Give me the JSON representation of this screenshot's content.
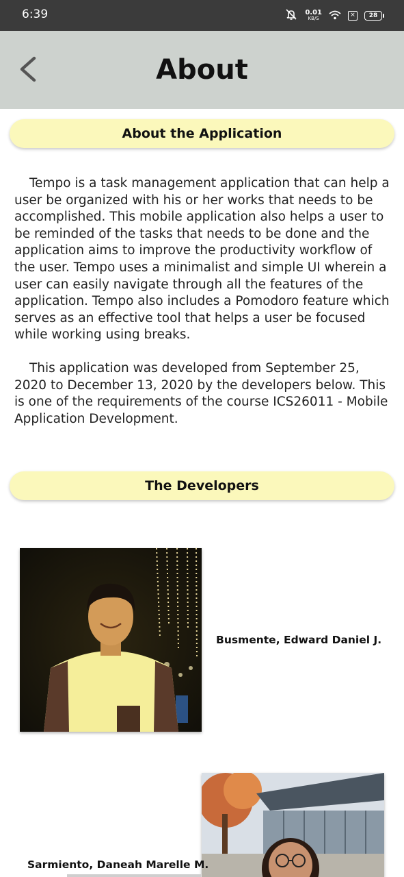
{
  "status_bar": {
    "time": "6:39",
    "net_speed_value": "0.01",
    "net_speed_unit": "KB/S",
    "sim_label": "×",
    "battery_level": "28"
  },
  "header": {
    "title": "About",
    "back_icon": "chevron-left-icon"
  },
  "about_section": {
    "heading": "About the Application",
    "paragraph1": "Tempo is a task management application that can help a user be organized with his or her works that needs to be accomplished. This mobile application also helps a user to be reminded of the tasks that needs to be done and the application aims to improve the productivity workflow of the user. Tempo uses a minimalist and simple UI wherein a user can easily navigate through all the features of the application. Tempo also includes a Pomodoro feature which serves as an effective tool that helps a user be focused while working using breaks.",
    "paragraph2": "This application was developed from September 25, 2020 to December 13, 2020 by the developers below. This is one of the requirements of the course ICS26011 - Mobile Application Development."
  },
  "developers_section": {
    "heading": "The Developers",
    "developers": [
      {
        "name": "Busmente, Edward Daniel J."
      },
      {
        "name": "Sarmiento, Daneah Marelle M."
      }
    ]
  },
  "colors": {
    "status_bar_bg": "#3b3b3b",
    "app_bar_bg": "#cdd2ce",
    "pill_bg": "#fbf8bb"
  }
}
